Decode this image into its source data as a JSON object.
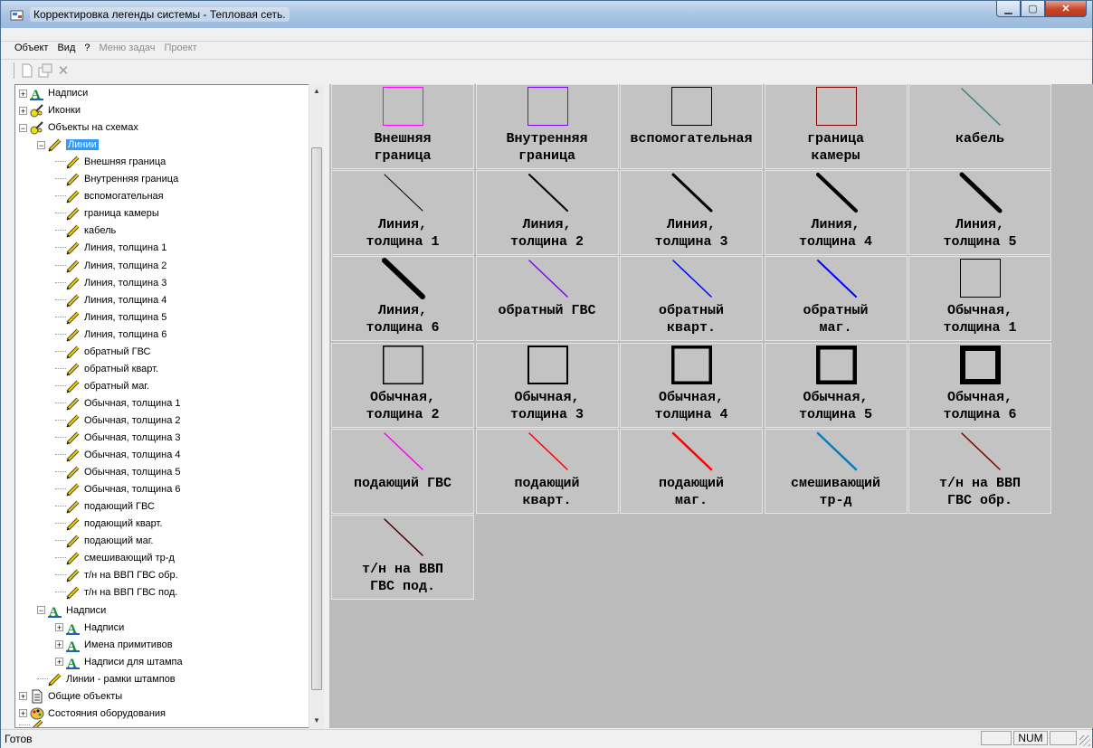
{
  "window": {
    "title": "Корректировка легенды системы - Тепловая сеть."
  },
  "menu": [
    {
      "label": "Объект",
      "enabled": true
    },
    {
      "label": "Вид",
      "enabled": true
    },
    {
      "label": "?",
      "enabled": true
    },
    {
      "label": "Меню задач",
      "enabled": false
    },
    {
      "label": "Проект",
      "enabled": false
    }
  ],
  "toolbar": {
    "new_icon": "new-doc-icon",
    "props_icon": "properties-icon",
    "delete_icon": "delete-icon"
  },
  "tree": [
    {
      "label": "Надписи",
      "level": 0,
      "exp": "+",
      "icon": "text-icon"
    },
    {
      "label": "Иконки",
      "level": 0,
      "exp": "+",
      "icon": "brush-icon"
    },
    {
      "label": "Объекты на схемах",
      "level": 0,
      "exp": "-",
      "icon": "brush-icon"
    },
    {
      "label": "Линии",
      "level": 1,
      "exp": "-",
      "icon": "pencil-icon",
      "selected": true
    },
    {
      "label": "Внешняя граница",
      "level": 2,
      "exp": "",
      "icon": "pencil-icon"
    },
    {
      "label": "Внутренняя граница",
      "level": 2,
      "exp": "",
      "icon": "pencil-icon"
    },
    {
      "label": "вспомогательная",
      "level": 2,
      "exp": "",
      "icon": "pencil-icon"
    },
    {
      "label": "граница камеры",
      "level": 2,
      "exp": "",
      "icon": "pencil-icon"
    },
    {
      "label": "кабель",
      "level": 2,
      "exp": "",
      "icon": "pencil-icon"
    },
    {
      "label": "Линия, толщина 1",
      "level": 2,
      "exp": "",
      "icon": "pencil-icon"
    },
    {
      "label": "Линия, толщина 2",
      "level": 2,
      "exp": "",
      "icon": "pencil-icon"
    },
    {
      "label": "Линия, толщина 3",
      "level": 2,
      "exp": "",
      "icon": "pencil-icon"
    },
    {
      "label": "Линия, толщина 4",
      "level": 2,
      "exp": "",
      "icon": "pencil-icon"
    },
    {
      "label": "Линия, толщина 5",
      "level": 2,
      "exp": "",
      "icon": "pencil-icon"
    },
    {
      "label": "Линия, толщина 6",
      "level": 2,
      "exp": "",
      "icon": "pencil-icon"
    },
    {
      "label": "обратный ГВС",
      "level": 2,
      "exp": "",
      "icon": "pencil-icon"
    },
    {
      "label": "обратный кварт.",
      "level": 2,
      "exp": "",
      "icon": "pencil-icon"
    },
    {
      "label": "обратный маг.",
      "level": 2,
      "exp": "",
      "icon": "pencil-icon"
    },
    {
      "label": "Обычная, толщина 1",
      "level": 2,
      "exp": "",
      "icon": "pencil-icon"
    },
    {
      "label": "Обычная, толщина 2",
      "level": 2,
      "exp": "",
      "icon": "pencil-icon"
    },
    {
      "label": "Обычная, толщина 3",
      "level": 2,
      "exp": "",
      "icon": "pencil-icon"
    },
    {
      "label": "Обычная, толщина 4",
      "level": 2,
      "exp": "",
      "icon": "pencil-icon"
    },
    {
      "label": "Обычная, толщина 5",
      "level": 2,
      "exp": "",
      "icon": "pencil-icon"
    },
    {
      "label": "Обычная, толщина 6",
      "level": 2,
      "exp": "",
      "icon": "pencil-icon"
    },
    {
      "label": "подающий ГВС",
      "level": 2,
      "exp": "",
      "icon": "pencil-icon"
    },
    {
      "label": "подающий кварт.",
      "level": 2,
      "exp": "",
      "icon": "pencil-icon"
    },
    {
      "label": "подающий маг.",
      "level": 2,
      "exp": "",
      "icon": "pencil-icon"
    },
    {
      "label": "смешивающий тр-д",
      "level": 2,
      "exp": "",
      "icon": "pencil-icon"
    },
    {
      "label": "т/н на ВВП ГВС обр.",
      "level": 2,
      "exp": "",
      "icon": "pencil-icon"
    },
    {
      "label": "т/н на ВВП ГВС под.",
      "level": 2,
      "exp": "",
      "icon": "pencil-icon"
    },
    {
      "label": "Надписи",
      "level": 1,
      "exp": "-",
      "icon": "text-icon"
    },
    {
      "label": "Надписи",
      "level": 2,
      "exp": "+",
      "icon": "text-icon"
    },
    {
      "label": "Имена примитивов",
      "level": 2,
      "exp": "+",
      "icon": "text-icon"
    },
    {
      "label": "Надписи для штампа",
      "level": 2,
      "exp": "+",
      "icon": "text-icon"
    },
    {
      "label": "Линии - рамки штампов",
      "level": 1,
      "exp": "",
      "icon": "pencil-icon"
    },
    {
      "label": "Общие объекты",
      "level": 0,
      "exp": "+",
      "icon": "document-icon"
    },
    {
      "label": "Состояния оборудования",
      "level": 0,
      "exp": "+",
      "icon": "palette-icon"
    },
    {
      "label": "...",
      "level": 0,
      "exp": "",
      "icon": "pencil-icon",
      "clipped": true
    }
  ],
  "cells": [
    {
      "lines": [
        "Внешняя",
        "граница"
      ],
      "kind": "rect",
      "color": "#ff00ff",
      "width": 1
    },
    {
      "lines": [
        "Внутренняя",
        "граница"
      ],
      "kind": "rect",
      "color": "#8000ff",
      "width": 1
    },
    {
      "lines": [
        "вспомогательная"
      ],
      "kind": "rect",
      "color": "#000000",
      "width": 1
    },
    {
      "lines": [
        "граница",
        "камеры"
      ],
      "kind": "rect",
      "color": "#800000",
      "width": 1
    },
    {
      "lines": [
        "кабель"
      ],
      "kind": "line",
      "color": "#408080",
      "width": 1.5
    },
    {
      "lines": [
        "Линия,",
        "толщина 1"
      ],
      "kind": "line",
      "color": "#000000",
      "width": 1
    },
    {
      "lines": [
        "Линия,",
        "толщина 2"
      ],
      "kind": "line",
      "color": "#000000",
      "width": 2
    },
    {
      "lines": [
        "Линия,",
        "толщина 3"
      ],
      "kind": "line",
      "color": "#000000",
      "width": 3
    },
    {
      "lines": [
        "Линия,",
        "толщина 4"
      ],
      "kind": "line",
      "color": "#000000",
      "width": 4
    },
    {
      "lines": [
        "Линия,",
        "толщина 5"
      ],
      "kind": "line",
      "color": "#000000",
      "width": 5
    },
    {
      "lines": [
        "Линия,",
        "толщина 6"
      ],
      "kind": "line",
      "color": "#000000",
      "width": 6
    },
    {
      "lines": [
        "обратный ГВС"
      ],
      "kind": "line",
      "color": "#8000ff",
      "width": 1.5
    },
    {
      "lines": [
        "обратный",
        "кварт."
      ],
      "kind": "line",
      "color": "#0000ff",
      "width": 1.5
    },
    {
      "lines": [
        "обратный",
        "маг."
      ],
      "kind": "line",
      "color": "#0000ff",
      "width": 2
    },
    {
      "lines": [
        "Обычная,",
        "толщина 1"
      ],
      "kind": "rect",
      "color": "#000000",
      "width": 1
    },
    {
      "lines": [
        "Обычная,",
        "толщина 2"
      ],
      "kind": "rect",
      "color": "#000000",
      "width": 1.5
    },
    {
      "lines": [
        "Обычная,",
        "толщина 3"
      ],
      "kind": "rect",
      "color": "#000000",
      "width": 2
    },
    {
      "lines": [
        "Обычная,",
        "толщина 4"
      ],
      "kind": "rect",
      "color": "#000000",
      "width": 3.5
    },
    {
      "lines": [
        "Обычная,",
        "толщина 5"
      ],
      "kind": "rect",
      "color": "#000000",
      "width": 4.5
    },
    {
      "lines": [
        "Обычная,",
        "толщина 6"
      ],
      "kind": "rect",
      "color": "#000000",
      "width": 6
    },
    {
      "lines": [
        "подающий ГВС"
      ],
      "kind": "line",
      "color": "#ff00ff",
      "width": 1.5
    },
    {
      "lines": [
        "подающий",
        "кварт."
      ],
      "kind": "line",
      "color": "#ff0000",
      "width": 1.5
    },
    {
      "lines": [
        "подающий",
        "маг."
      ],
      "kind": "line",
      "color": "#ff0000",
      "width": 2.5
    },
    {
      "lines": [
        "смешивающий",
        "тр-д"
      ],
      "kind": "line",
      "color": "#0080c0",
      "width": 2.5
    },
    {
      "lines": [
        "т/н на ВВП",
        "ГВС обр."
      ],
      "kind": "line",
      "color": "#800000",
      "width": 1.5
    },
    {
      "lines": [
        "т/н на ВВП",
        "ГВС под."
      ],
      "kind": "line",
      "color": "#400000",
      "width": 1.5
    }
  ],
  "status": {
    "text": "Готов",
    "num": "NUM"
  }
}
